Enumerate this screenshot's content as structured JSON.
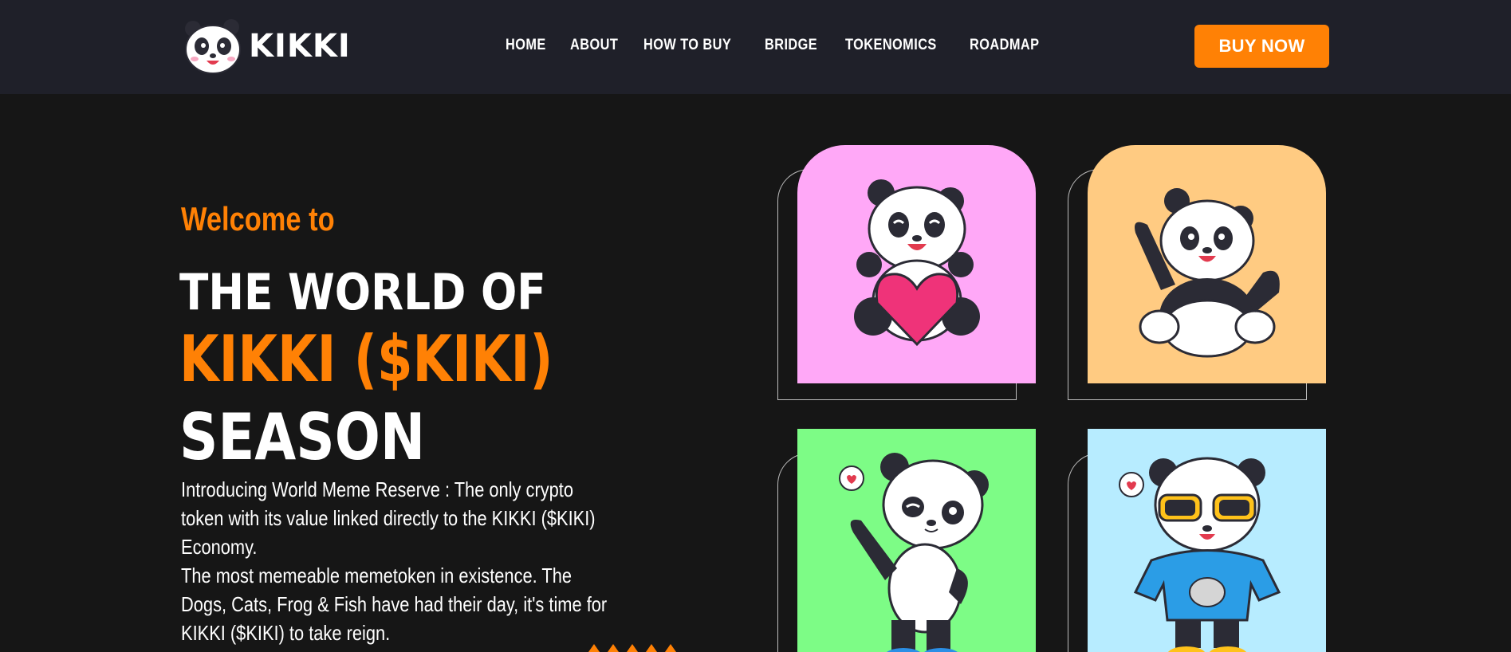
{
  "header": {
    "logo_text": "KIKKI",
    "nav": [
      {
        "label": "HOME"
      },
      {
        "label": "ABOUT"
      },
      {
        "label": "HOW TO BUY"
      },
      {
        "label": "BRIDGE"
      },
      {
        "label": "TOKENOMICS"
      },
      {
        "label": "ROADMAP"
      }
    ],
    "buy_label": "BUY NOW"
  },
  "hero": {
    "welcome": "Welcome to",
    "line1": "THE WORLD OF",
    "line2": "KIKKI ($KIKI)",
    "line3": "SEASON",
    "paragraph1": "Introducing World Meme Reserve : The only crypto token with its value linked directly to the KIKKI ($KIKI) Economy.",
    "paragraph2": "The most memeable memetoken in existence. The Dogs, Cats, Frog & Fish have had their day, it's time for KIKKI ($KIKI) to take reign."
  },
  "cards": [
    {
      "name": "panda-heart",
      "bg": "#ffa8f7"
    },
    {
      "name": "panda-wave",
      "bg": "#ffcb82"
    },
    {
      "name": "panda-wink",
      "bg": "#7dfc86"
    },
    {
      "name": "panda-sunglasses",
      "bg": "#b7ecff"
    }
  ],
  "colors": {
    "accent": "#ff8105",
    "header_bg": "#1f2029",
    "page_bg": "#161616"
  }
}
